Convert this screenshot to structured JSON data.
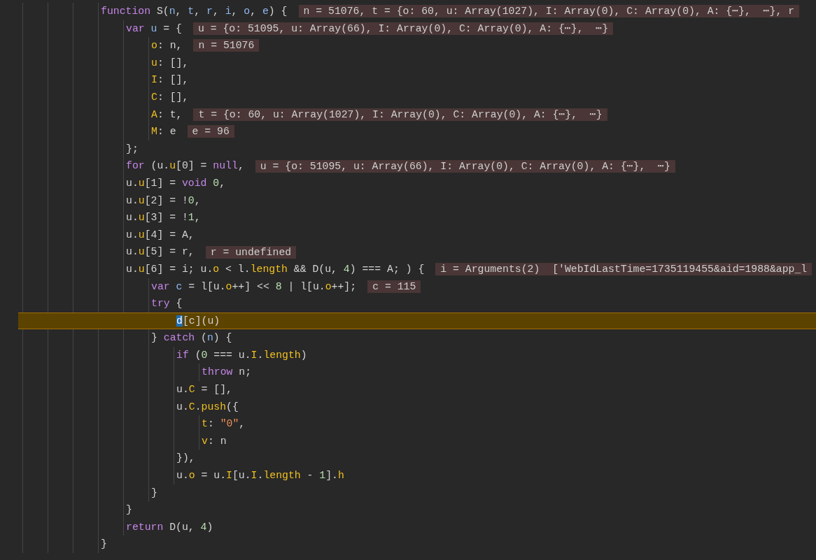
{
  "lines": [
    {
      "tokens": [
        {
          "kind": "kw",
          "text": "function"
        },
        {
          "kind": "plain",
          "text": " S("
        },
        {
          "kind": "param",
          "text": "n"
        },
        {
          "kind": "plain",
          "text": ", "
        },
        {
          "kind": "param",
          "text": "t"
        },
        {
          "kind": "plain",
          "text": ", "
        },
        {
          "kind": "param",
          "text": "r"
        },
        {
          "kind": "plain",
          "text": ", "
        },
        {
          "kind": "param",
          "text": "i"
        },
        {
          "kind": "plain",
          "text": ", "
        },
        {
          "kind": "param",
          "text": "o"
        },
        {
          "kind": "plain",
          "text": ", "
        },
        {
          "kind": "param",
          "text": "e"
        },
        {
          "kind": "plain",
          "text": ") {"
        }
      ],
      "inline_value": "n = 51076, t = {o: 60, u: Array(1027), I: Array(0), C: Array(0), A: {⋯},  ⋯}, r",
      "current": false,
      "children": [
        {
          "tokens": [
            {
              "kind": "kw",
              "text": "var "
            },
            {
              "kind": "param",
              "text": "u"
            },
            {
              "kind": "plain",
              "text": " = {"
            }
          ],
          "inline_value": "u = {o: 51095, u: Array(66), I: Array(0), C: Array(0), A: {⋯},  ⋯}",
          "current": false,
          "children": [
            {
              "tokens": [
                {
                  "kind": "prop",
                  "text": "o"
                },
                {
                  "kind": "plain",
                  "text": ": n,"
                }
              ],
              "inline_value": "n = 51076",
              "current": false
            },
            {
              "tokens": [
                {
                  "kind": "prop",
                  "text": "u"
                },
                {
                  "kind": "plain",
                  "text": ": [],"
                }
              ],
              "current": false
            },
            {
              "tokens": [
                {
                  "kind": "prop",
                  "text": "I"
                },
                {
                  "kind": "plain",
                  "text": ": [],"
                }
              ],
              "current": false
            },
            {
              "tokens": [
                {
                  "kind": "prop",
                  "text": "C"
                },
                {
                  "kind": "plain",
                  "text": ": [],"
                }
              ],
              "current": false
            },
            {
              "tokens": [
                {
                  "kind": "prop",
                  "text": "A"
                },
                {
                  "kind": "plain",
                  "text": ": t,"
                }
              ],
              "inline_value": "t = {o: 60, u: Array(1027), I: Array(0), C: Array(0), A: {⋯},  ⋯}",
              "current": false
            },
            {
              "tokens": [
                {
                  "kind": "prop",
                  "text": "M"
                },
                {
                  "kind": "plain",
                  "text": ": e"
                }
              ],
              "inline_value": "e = 96",
              "current": false
            }
          ]
        },
        {
          "tokens": [
            {
              "kind": "plain",
              "text": "};"
            }
          ],
          "current": false
        },
        {
          "tokens": [
            {
              "kind": "kw",
              "text": "for"
            },
            {
              "kind": "plain",
              "text": " (u."
            },
            {
              "kind": "prop",
              "text": "u"
            },
            {
              "kind": "plain",
              "text": "[0] = "
            },
            {
              "kind": "kw",
              "text": "null"
            },
            {
              "kind": "plain",
              "text": ","
            }
          ],
          "inline_value": "u = {o: 51095, u: Array(66), I: Array(0), C: Array(0), A: {⋯},  ⋯}",
          "current": false
        },
        {
          "tokens": [
            {
              "kind": "plain",
              "text": "u."
            },
            {
              "kind": "prop",
              "text": "u"
            },
            {
              "kind": "plain",
              "text": "[1] = "
            },
            {
              "kind": "kw",
              "text": "void "
            },
            {
              "kind": "num",
              "text": "0"
            },
            {
              "kind": "plain",
              "text": ","
            }
          ],
          "current": false
        },
        {
          "tokens": [
            {
              "kind": "plain",
              "text": "u."
            },
            {
              "kind": "prop",
              "text": "u"
            },
            {
              "kind": "plain",
              "text": "[2] = !"
            },
            {
              "kind": "num",
              "text": "0"
            },
            {
              "kind": "plain",
              "text": ","
            }
          ],
          "current": false
        },
        {
          "tokens": [
            {
              "kind": "plain",
              "text": "u."
            },
            {
              "kind": "prop",
              "text": "u"
            },
            {
              "kind": "plain",
              "text": "[3] = !"
            },
            {
              "kind": "num",
              "text": "1"
            },
            {
              "kind": "plain",
              "text": ","
            }
          ],
          "current": false
        },
        {
          "tokens": [
            {
              "kind": "plain",
              "text": "u."
            },
            {
              "kind": "prop",
              "text": "u"
            },
            {
              "kind": "plain",
              "text": "[4] = A,"
            }
          ],
          "current": false
        },
        {
          "tokens": [
            {
              "kind": "plain",
              "text": "u."
            },
            {
              "kind": "prop",
              "text": "u"
            },
            {
              "kind": "plain",
              "text": "[5] = r,"
            }
          ],
          "inline_value": "r = undefined",
          "current": false
        },
        {
          "tokens": [
            {
              "kind": "plain",
              "text": "u."
            },
            {
              "kind": "prop",
              "text": "u"
            },
            {
              "kind": "plain",
              "text": "[6] = i; u."
            },
            {
              "kind": "prop",
              "text": "o"
            },
            {
              "kind": "plain",
              "text": " < l."
            },
            {
              "kind": "prop",
              "text": "length"
            },
            {
              "kind": "plain",
              "text": " && D(u, "
            },
            {
              "kind": "num",
              "text": "4"
            },
            {
              "kind": "plain",
              "text": ") === A; ) {"
            }
          ],
          "inline_value": "i = Arguments(2)  ['WebIdLastTime=1735119455&aid=1988&app_l",
          "current": false,
          "children": [
            {
              "tokens": [
                {
                  "kind": "kw",
                  "text": "var "
                },
                {
                  "kind": "param",
                  "text": "c"
                },
                {
                  "kind": "plain",
                  "text": " = l[u."
                },
                {
                  "kind": "prop",
                  "text": "o"
                },
                {
                  "kind": "plain",
                  "text": "++] << "
                },
                {
                  "kind": "num",
                  "text": "8"
                },
                {
                  "kind": "plain",
                  "text": " | l[u."
                },
                {
                  "kind": "prop",
                  "text": "o"
                },
                {
                  "kind": "plain",
                  "text": "++];"
                }
              ],
              "inline_value": "c = 115",
              "current": false
            },
            {
              "tokens": [
                {
                  "kind": "kw",
                  "text": "try"
                },
                {
                  "kind": "plain",
                  "text": " {"
                }
              ],
              "current": false,
              "children": [
                {
                  "tokens": [
                    {
                      "kind": "cursor",
                      "text": "d"
                    },
                    {
                      "kind": "plain",
                      "text": "[c](u)"
                    }
                  ],
                  "current": true
                }
              ]
            },
            {
              "tokens": [
                {
                  "kind": "plain",
                  "text": "} "
                },
                {
                  "kind": "kw",
                  "text": "catch"
                },
                {
                  "kind": "plain",
                  "text": " ("
                },
                {
                  "kind": "param",
                  "text": "n"
                },
                {
                  "kind": "plain",
                  "text": ") {"
                }
              ],
              "current": false,
              "children": [
                {
                  "tokens": [
                    {
                      "kind": "kw",
                      "text": "if"
                    },
                    {
                      "kind": "plain",
                      "text": " ("
                    },
                    {
                      "kind": "num",
                      "text": "0"
                    },
                    {
                      "kind": "plain",
                      "text": " === u."
                    },
                    {
                      "kind": "prop",
                      "text": "I"
                    },
                    {
                      "kind": "plain",
                      "text": "."
                    },
                    {
                      "kind": "prop",
                      "text": "length"
                    },
                    {
                      "kind": "plain",
                      "text": ")"
                    }
                  ],
                  "current": false,
                  "children": [
                    {
                      "tokens": [
                        {
                          "kind": "kw",
                          "text": "throw"
                        },
                        {
                          "kind": "plain",
                          "text": " n;"
                        }
                      ],
                      "current": false
                    }
                  ]
                },
                {
                  "tokens": [
                    {
                      "kind": "plain",
                      "text": "u."
                    },
                    {
                      "kind": "prop",
                      "text": "C"
                    },
                    {
                      "kind": "plain",
                      "text": " = [],"
                    }
                  ],
                  "current": false
                },
                {
                  "tokens": [
                    {
                      "kind": "plain",
                      "text": "u."
                    },
                    {
                      "kind": "prop",
                      "text": "C"
                    },
                    {
                      "kind": "plain",
                      "text": "."
                    },
                    {
                      "kind": "prop",
                      "text": "push"
                    },
                    {
                      "kind": "plain",
                      "text": "({"
                    }
                  ],
                  "current": false,
                  "children": [
                    {
                      "tokens": [
                        {
                          "kind": "prop",
                          "text": "t"
                        },
                        {
                          "kind": "plain",
                          "text": ": "
                        },
                        {
                          "kind": "str",
                          "text": "\"0\""
                        },
                        {
                          "kind": "plain",
                          "text": ","
                        }
                      ],
                      "current": false
                    },
                    {
                      "tokens": [
                        {
                          "kind": "prop",
                          "text": "v"
                        },
                        {
                          "kind": "plain",
                          "text": ": n"
                        }
                      ],
                      "current": false
                    }
                  ]
                },
                {
                  "tokens": [
                    {
                      "kind": "plain",
                      "text": "}),"
                    }
                  ],
                  "current": false
                },
                {
                  "tokens": [
                    {
                      "kind": "plain",
                      "text": "u."
                    },
                    {
                      "kind": "prop",
                      "text": "o"
                    },
                    {
                      "kind": "plain",
                      "text": " = u."
                    },
                    {
                      "kind": "prop",
                      "text": "I"
                    },
                    {
                      "kind": "plain",
                      "text": "[u."
                    },
                    {
                      "kind": "prop",
                      "text": "I"
                    },
                    {
                      "kind": "plain",
                      "text": "."
                    },
                    {
                      "kind": "prop",
                      "text": "length"
                    },
                    {
                      "kind": "plain",
                      "text": " - "
                    },
                    {
                      "kind": "num",
                      "text": "1"
                    },
                    {
                      "kind": "plain",
                      "text": "]."
                    },
                    {
                      "kind": "prop",
                      "text": "h"
                    }
                  ],
                  "current": false
                }
              ]
            },
            {
              "tokens": [
                {
                  "kind": "plain",
                  "text": "}"
                }
              ],
              "current": false
            }
          ]
        },
        {
          "tokens": [
            {
              "kind": "plain",
              "text": "}"
            }
          ],
          "current": false
        },
        {
          "tokens": [
            {
              "kind": "kw",
              "text": "return"
            },
            {
              "kind": "plain",
              "text": " D(u, "
            },
            {
              "kind": "num",
              "text": "4"
            },
            {
              "kind": "plain",
              "text": ")"
            }
          ],
          "current": false
        }
      ]
    },
    {
      "tokens": [
        {
          "kind": "plain",
          "text": "}"
        }
      ],
      "current": false
    }
  ]
}
